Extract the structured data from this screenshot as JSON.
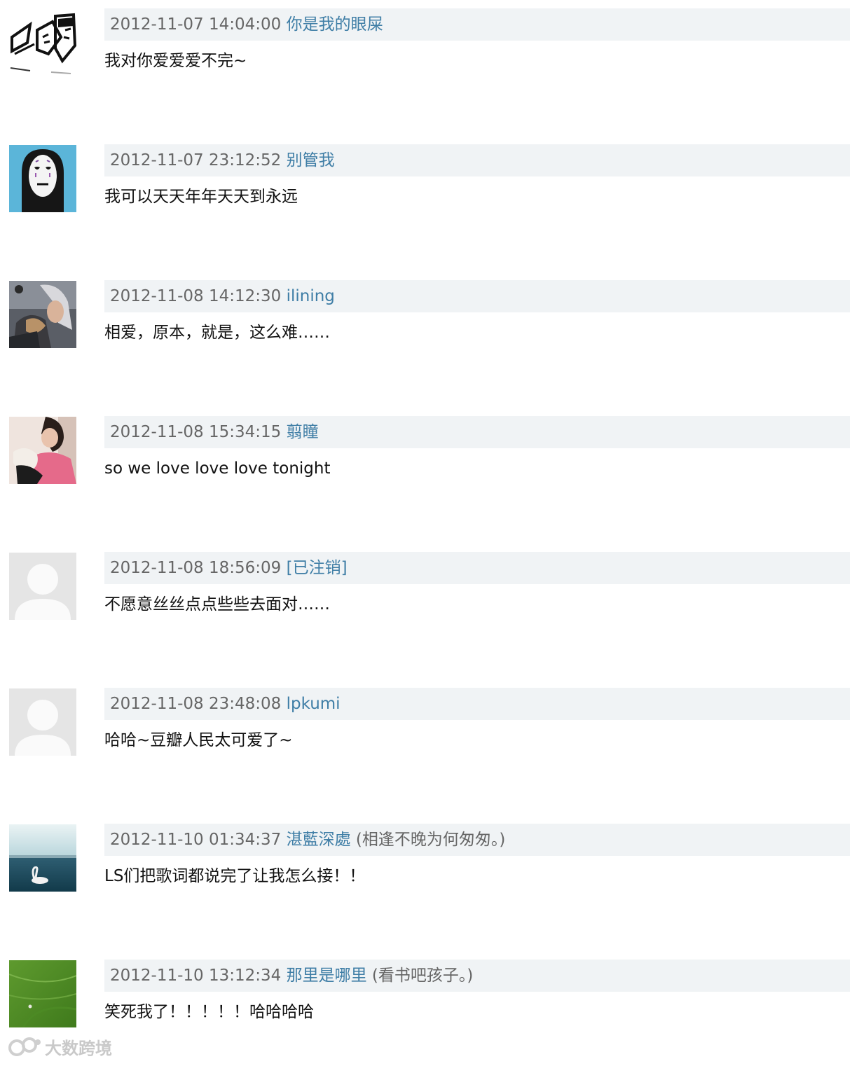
{
  "comments": [
    {
      "timestamp": "2012-11-07 14:04:00",
      "user": "你是我的眼屎",
      "signature": "",
      "text": "我对你爱爱爱不完~",
      "avatar": "sketch-faces"
    },
    {
      "timestamp": "2012-11-07 23:12:52",
      "user": "别管我",
      "signature": "",
      "text": "我可以天天年年天天到永远",
      "avatar": "no-face-mask"
    },
    {
      "timestamp": "2012-11-08 14:12:30",
      "user": "ilining",
      "signature": "",
      "text": "相爱，原本，就是，这么难……",
      "avatar": "silver-hair-person"
    },
    {
      "timestamp": "2012-11-08 15:34:15",
      "user": "翦瞳",
      "signature": "",
      "text": "so we love love love tonight",
      "avatar": "woman-photo"
    },
    {
      "timestamp": "2012-11-08 18:56:09",
      "user": "[已注销]",
      "signature": "",
      "text": "不愿意丝丝点点些些去面对……",
      "avatar": "default-user"
    },
    {
      "timestamp": "2012-11-08 23:48:08",
      "user": "lpkumi",
      "signature": "",
      "text": "哈哈~豆瓣人民太可爱了~",
      "avatar": "default-user"
    },
    {
      "timestamp": "2012-11-10 01:34:37",
      "user": "湛藍深處",
      "signature": "(相逢不晚为何匆匆。)",
      "text": "LS们把歌词都说完了让我怎么接！！",
      "avatar": "swan-sea"
    },
    {
      "timestamp": "2012-11-10 13:12:34",
      "user": "那里是哪里",
      "signature": "(看书吧孩子。)",
      "text": "笑死我了！！！！！哈哈哈哈",
      "avatar": "green-field"
    }
  ],
  "watermark": {
    "text": "大数跨境",
    "icon": "watermark-logo-icon"
  },
  "colors": {
    "header_bg": "#f0f3f5",
    "username": "#3f7ea6",
    "timestamp": "#666666",
    "text": "#111111"
  }
}
